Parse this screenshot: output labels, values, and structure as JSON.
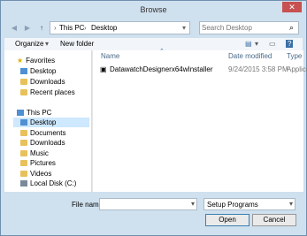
{
  "window": {
    "title": "Browse",
    "close_glyph": "✕"
  },
  "nav": {
    "back_icon": "back-arrow-icon",
    "forward_icon": "forward-arrow-icon",
    "up_icon": "up-arrow-icon",
    "breadcrumb": [
      "This PC",
      "Desktop"
    ],
    "search_placeholder": "Search Desktop"
  },
  "toolbar": {
    "organize": "Organize",
    "new_folder": "New folder"
  },
  "sidebar": {
    "favorites": {
      "label": "Favorites",
      "items": [
        "Desktop",
        "Downloads",
        "Recent places"
      ]
    },
    "this_pc": {
      "label": "This PC",
      "items": [
        "Desktop",
        "Documents",
        "Downloads",
        "Music",
        "Pictures",
        "Videos",
        "Local Disk (C:)"
      ]
    }
  },
  "columns": {
    "name": "Name",
    "date": "Date modified",
    "type": "Type"
  },
  "files": [
    {
      "name": "DatawatchDesignerx64wInstaller",
      "date": "9/24/2015 3:58 PM",
      "type": "Applica"
    }
  ],
  "footer": {
    "file_name_label": "File name:",
    "file_name_value": "",
    "file_type": "Setup Programs",
    "open": "Open",
    "cancel": "Cancel"
  },
  "colors": {
    "selected": "#cde8ff",
    "close": "#c75050"
  }
}
